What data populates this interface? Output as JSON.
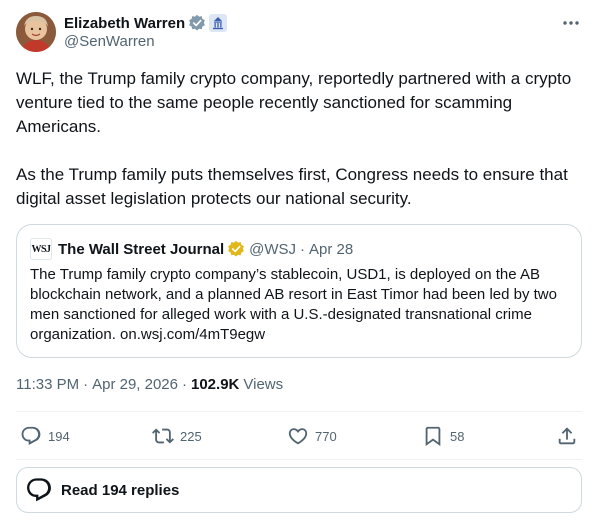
{
  "author": {
    "display_name": "Elizabeth Warren",
    "handle": "@SenWarren",
    "avatar_icon": "avatar-photo",
    "verified_color": "#829aab"
  },
  "tweet": {
    "paragraphs": [
      "WLF, the Trump family crypto company, reportedly partnered with a crypto venture tied to the same people recently sanctioned for scamming Americans.",
      "As the Trump family puts themselves first, Congress needs to ensure that digital asset legislation protects our national security."
    ]
  },
  "quote": {
    "logo_text": "WSJ",
    "name": "The Wall Street Journal",
    "handle": "@WSJ",
    "separator": "·",
    "date": "Apr 28",
    "text": "The Trump family crypto company’s stablecoin, USD1, is deployed on the AB blockchain network, and a planned AB resort in East Timor had been led by two men sanctioned for alleged work with a U.S.-designated transnational crime organization. on.wsj.com/4mT9egw",
    "verified_color": "#e2b719"
  },
  "meta": {
    "time": "11:33 PM",
    "separator": "·",
    "date": "Apr 29, 2026",
    "views_count": "102.9K",
    "views_label": "Views"
  },
  "actions": {
    "replies": "194",
    "reposts": "225",
    "likes": "770",
    "bookmarks": "58"
  },
  "read_replies_label": "Read 194 replies"
}
